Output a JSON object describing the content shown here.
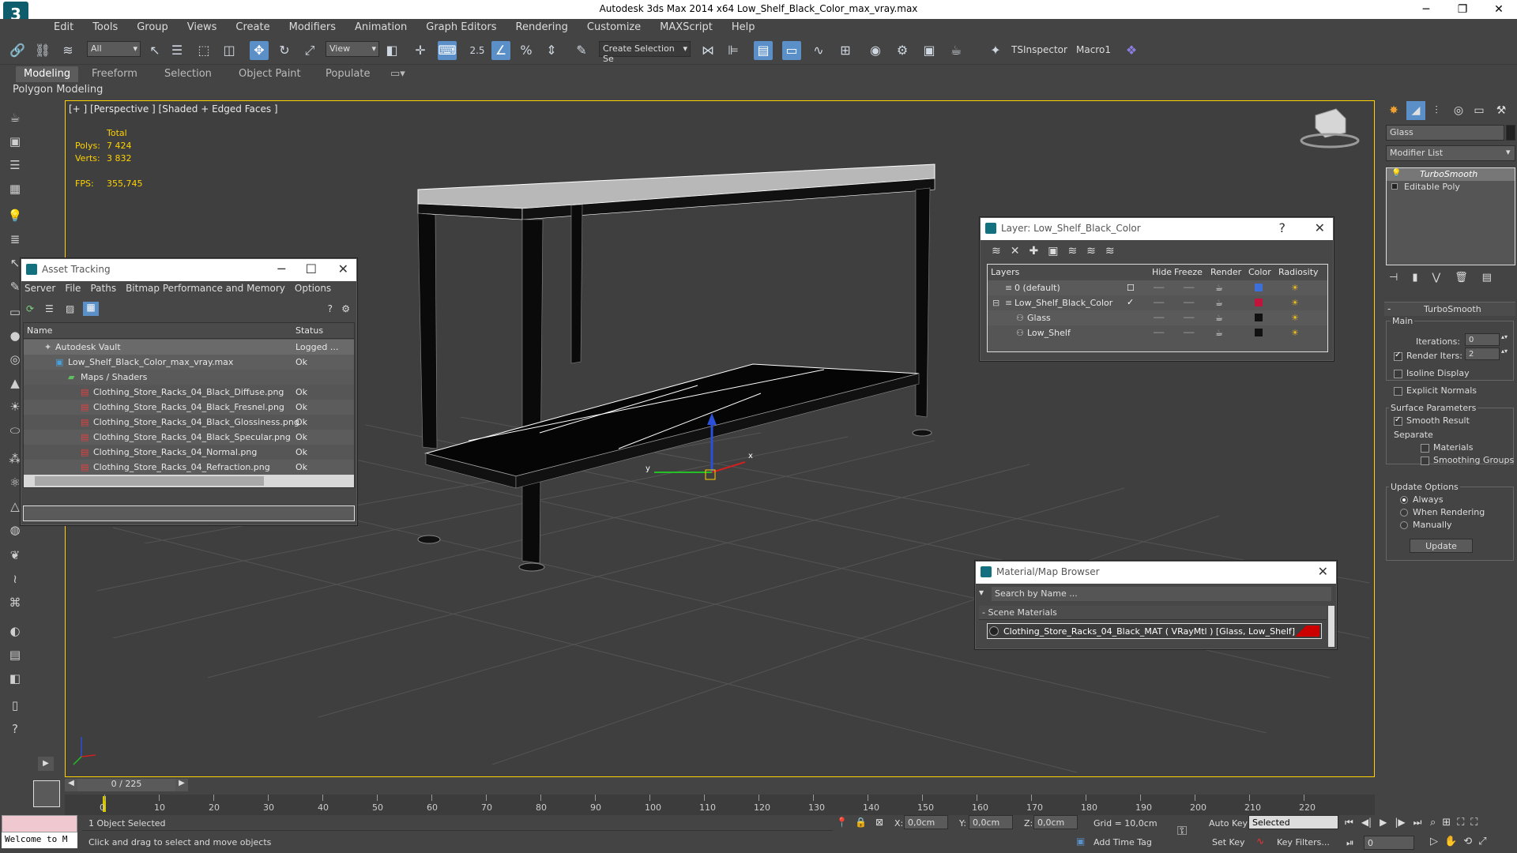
{
  "window": {
    "title": "Autodesk 3ds Max  2014 x64     Low_Shelf_Black_Color_max_vray.max",
    "app_logo": "3",
    "minimize": "─",
    "restore": "❐",
    "close": "✕"
  },
  "menu": [
    "Edit",
    "Tools",
    "Group",
    "Views",
    "Create",
    "Modifiers",
    "Animation",
    "Graph Editors",
    "Rendering",
    "Customize",
    "MAXScript",
    "Help"
  ],
  "toolbar": {
    "filter_select": "All",
    "view_select": "View",
    "snap_value": "2.5",
    "selection_set_placeholder": "Create Selection Se",
    "tsinspector": "TSInspector",
    "macro1": "Macro1"
  },
  "ribbon": {
    "tabs": [
      "Modeling",
      "Freeform",
      "Selection",
      "Object Paint",
      "Populate"
    ],
    "active_tab": "Modeling",
    "sub_label": "Polygon Modeling"
  },
  "viewport": {
    "label": "[+ ] [Perspective ] [Shaded + Edged Faces ]",
    "stats_total": "Total",
    "polys_label": "Polys:",
    "polys_value": "7 424",
    "verts_label": "Verts:",
    "verts_value": "3 832",
    "fps_label": "FPS:",
    "fps_value": "355,745"
  },
  "asset_tracking": {
    "title": "Asset Tracking",
    "menu": [
      "Server",
      "File",
      "Paths",
      "Bitmap Performance and Memory",
      "Options"
    ],
    "columns": [
      "Name",
      "Status"
    ],
    "rows": [
      {
        "name": "Autodesk Vault",
        "status": "Logged ..."
      },
      {
        "name": "Low_Shelf_Black_Color_max_vray.max",
        "status": "Ok"
      },
      {
        "name": "Maps / Shaders",
        "status": ""
      },
      {
        "name": "Clothing_Store_Racks_04_Black_Diffuse.png",
        "status": "Ok"
      },
      {
        "name": "Clothing_Store_Racks_04_Black_Fresnel.png",
        "status": "Ok"
      },
      {
        "name": "Clothing_Store_Racks_04_Black_Glossiness.png",
        "status": "Ok"
      },
      {
        "name": "Clothing_Store_Racks_04_Black_Specular.png",
        "status": "Ok"
      },
      {
        "name": "Clothing_Store_Racks_04_Normal.png",
        "status": "Ok"
      },
      {
        "name": "Clothing_Store_Racks_04_Refraction.png",
        "status": "Ok"
      }
    ]
  },
  "layer_panel": {
    "title": "Layer: Low_Shelf_Black_Color",
    "help": "?",
    "columns": [
      "Layers",
      "Hide",
      "Freeze",
      "Render",
      "Color",
      "Radiosity"
    ],
    "rows": [
      {
        "name": "0 (default)",
        "color": "#3c6fd8"
      },
      {
        "name": "Low_Shelf_Black_Color",
        "color": "#c0143c"
      },
      {
        "name": "Glass",
        "color": "#111111"
      },
      {
        "name": "Low_Shelf",
        "color": "#111111"
      }
    ]
  },
  "material_browser": {
    "title": "Material/Map Browser",
    "search_placeholder": "Search by Name ...",
    "section": "- Scene Materials",
    "material": "Clothing_Store_Racks_04_Black_MAT  ( VRayMtl )  [Glass, Low_Shelf]"
  },
  "command_panel": {
    "object_name": "Glass",
    "modifier_list": "Modifier List",
    "stack": [
      "TurboSmooth",
      "Editable Poly"
    ],
    "rollout_title": "TurboSmooth",
    "main_group": "Main",
    "iterations_label": "Iterations:",
    "iterations_value": "0",
    "render_iters_label": "Render Iters:",
    "render_iters_value": "2",
    "isoline_display": "Isoline Display",
    "explicit_normals": "Explicit Normals",
    "surface_params": "Surface Parameters",
    "smooth_result": "Smooth Result",
    "separate": "Separate",
    "materials": "Materials",
    "smoothing_groups": "Smoothing Groups",
    "update_options": "Update Options",
    "always": "Always",
    "when_rendering": "When Rendering",
    "manually": "Manually",
    "update_button": "Update"
  },
  "timeline": {
    "frame_counter": "0 / 225",
    "ticks": [
      "0",
      "10",
      "20",
      "30",
      "40",
      "50",
      "60",
      "70",
      "80",
      "90",
      "100",
      "110",
      "120",
      "130",
      "140",
      "150",
      "160",
      "170",
      "180",
      "190",
      "200",
      "210",
      "220"
    ]
  },
  "status": {
    "script_field": "Welcome to M",
    "selection": "1 Object Selected",
    "prompt": "Click and drag to select and move objects",
    "x_label": "X:",
    "x_value": "0,0cm",
    "y_label": "Y:",
    "y_value": "0,0cm",
    "z_label": "Z:",
    "z_value": "0,0cm",
    "grid": "Grid = 10,0cm",
    "add_time_tag": "Add Time Tag",
    "auto_key": "Auto Key",
    "selected": "Selected",
    "set_key": "Set Key",
    "key_filters": "Key Filters...",
    "frame_value": "0"
  },
  "colors": {
    "viewport_border": "#ffd200",
    "accent": "#5b8fc7",
    "material_swatch": "#cc0000"
  }
}
